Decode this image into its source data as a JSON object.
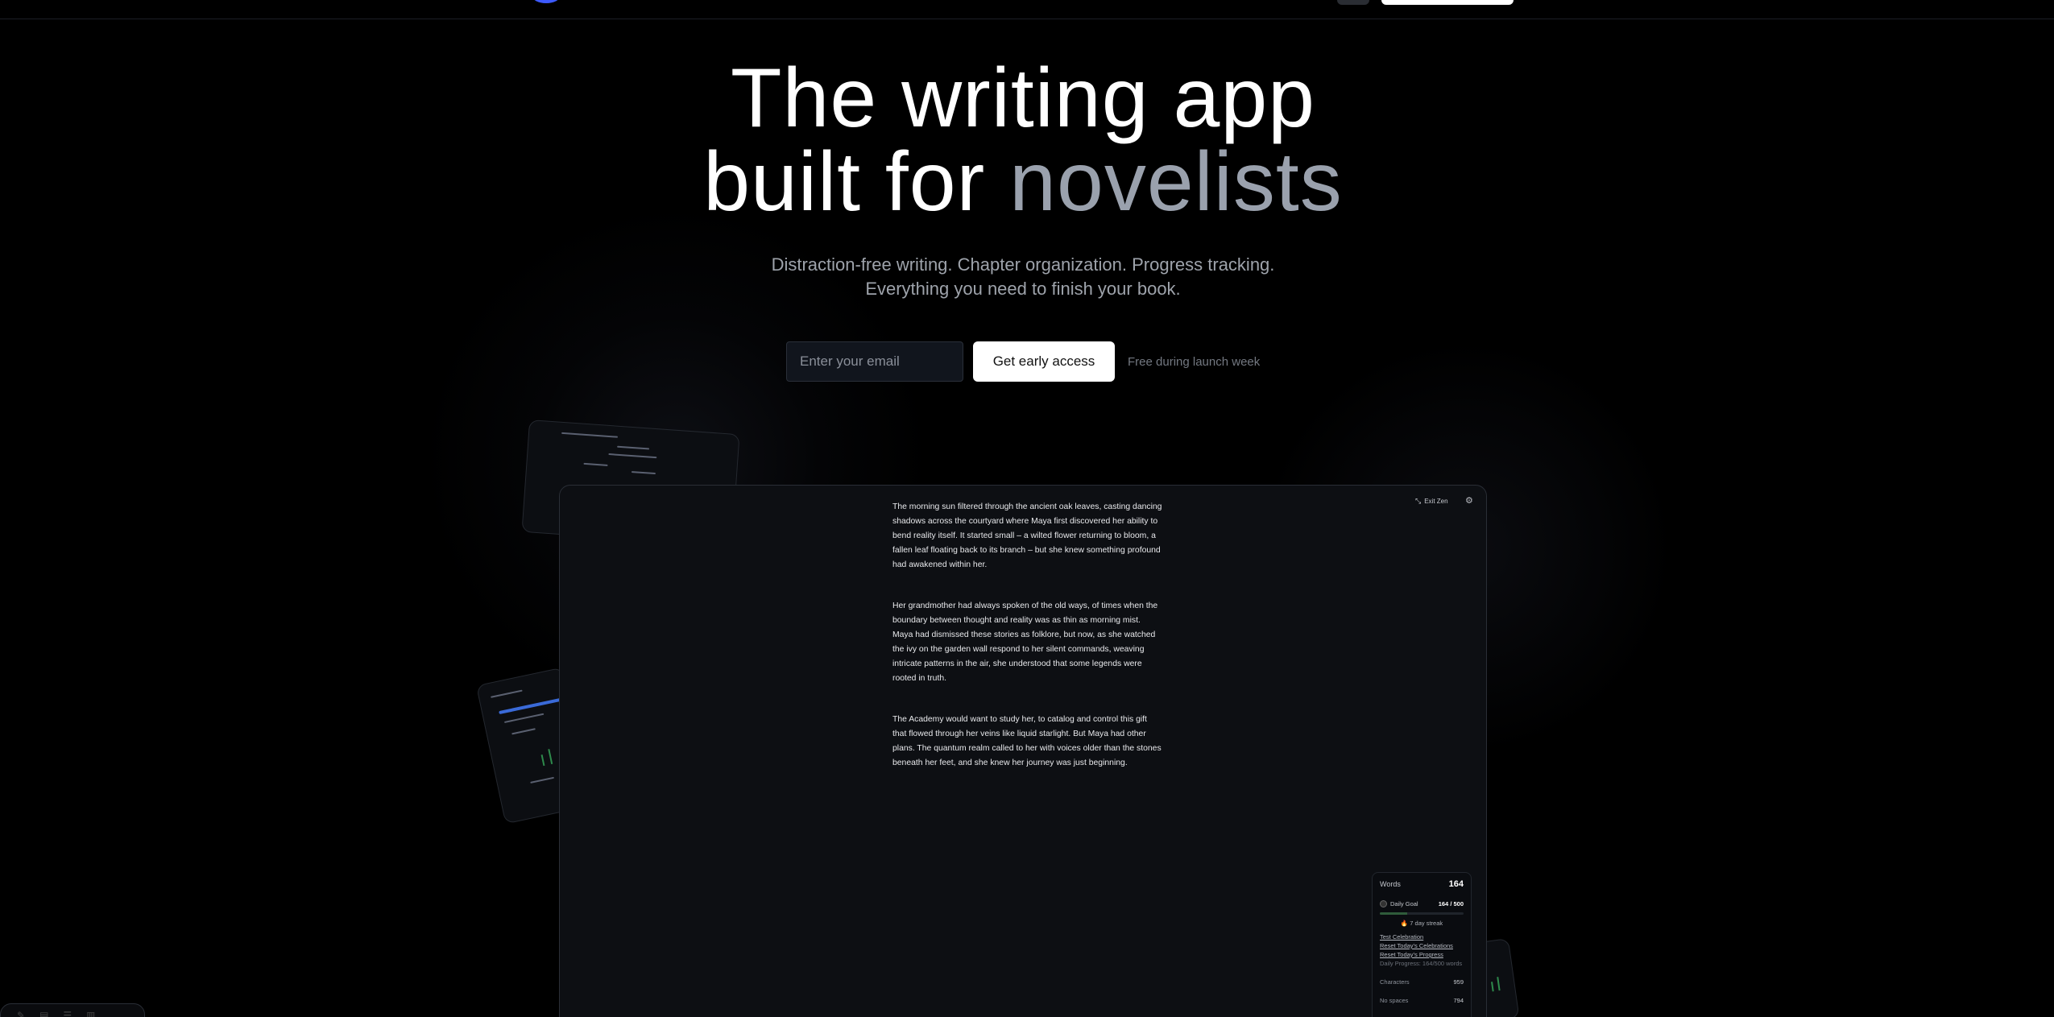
{
  "hero": {
    "title_line1": "The writing app",
    "title_line2_prefix": "built for ",
    "title_line2_accent": "novelists",
    "subtitle_line1": "Distraction-free writing. Chapter organization. Progress tracking.",
    "subtitle_line2": "Everything you need to finish your book."
  },
  "signup": {
    "email_placeholder": "Enter your email",
    "cta_label": "Get early access",
    "note": "Free during launch week"
  },
  "editor": {
    "exit_zen_label": "Exit Zen",
    "paragraphs": [
      "The morning sun filtered through the ancient oak leaves, casting dancing shadows across the courtyard where Maya first discovered her ability to bend reality itself. It started small – a wilted flower returning to bloom, a fallen leaf floating back to its branch – but she knew something profound had awakened within her.",
      "Her grandmother had always spoken of the old ways, of times when the boundary between thought and reality was as thin as morning mist. Maya had dismissed these stories as folklore, but now, as she watched the ivy on the garden wall respond to her silent commands, weaving intricate patterns in the air, she understood that some legends were rooted in truth.",
      "The Academy would want to study her, to catalog and control this gift that flowed through her veins like liquid starlight. But Maya had other plans. The quantum realm called to her with voices older than the stones beneath her feet, and she knew her journey was just beginning."
    ],
    "stats": {
      "words_label": "Words",
      "words_value": "164",
      "daily_goal_label": "Daily Goal",
      "daily_goal_value": "164 / 500",
      "goal_progress": 0.328,
      "streak": "🔥 7 day streak",
      "links": [
        "Test Celebration",
        "Reset Today's Celebrations",
        "Reset Today's Progress"
      ],
      "daily_progress": "Daily Progress: 164/500 words",
      "characters_label": "Characters",
      "characters_value": "959",
      "no_spaces_label": "No spaces",
      "no_spaces_value": "794"
    }
  },
  "colors": {
    "background": "#000000",
    "accent_text": "#9aa1ad",
    "cta_bg": "#ffffff",
    "goal_fill": "#2f5c3b"
  }
}
